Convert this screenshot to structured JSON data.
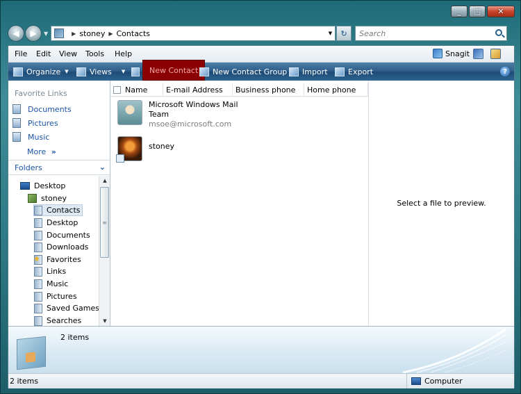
{
  "window": {
    "minimize": "_",
    "maximize": "□",
    "close": "✕"
  },
  "address": {
    "path": [
      "stoney",
      "Contacts"
    ],
    "search_placeholder": "Search"
  },
  "menu": [
    "File",
    "Edit",
    "View",
    "Tools",
    "Help"
  ],
  "snagit_label": "Snagit",
  "toolbar": {
    "organize": "Organize",
    "views": "Views",
    "new_contact": "New Contact",
    "new_contact_group": "New Contact Group",
    "import": "Import",
    "export": "Export",
    "help": "?"
  },
  "favorites": {
    "title": "Favorite Links",
    "items": [
      "Documents",
      "Pictures",
      "Music"
    ],
    "more": "More"
  },
  "folders": {
    "title": "Folders",
    "tree": [
      {
        "label": "Desktop",
        "level": 0,
        "icon": "desktop-icon"
      },
      {
        "label": "stoney",
        "level": 1,
        "icon": "user-folder-icon"
      },
      {
        "label": "Contacts",
        "level": 2,
        "icon": "folder-icon",
        "selected": true
      },
      {
        "label": "Desktop",
        "level": 2,
        "icon": "folder-icon"
      },
      {
        "label": "Documents",
        "level": 2,
        "icon": "folder-icon"
      },
      {
        "label": "Downloads",
        "level": 2,
        "icon": "folder-icon"
      },
      {
        "label": "Favorites",
        "level": 2,
        "icon": "favorites-folder-icon"
      },
      {
        "label": "Links",
        "level": 2,
        "icon": "folder-icon"
      },
      {
        "label": "Music",
        "level": 2,
        "icon": "music-folder-icon"
      },
      {
        "label": "Pictures",
        "level": 2,
        "icon": "folder-icon"
      },
      {
        "label": "Saved Games",
        "level": 2,
        "icon": "folder-icon"
      },
      {
        "label": "Searches",
        "level": 2,
        "icon": "folder-icon"
      }
    ]
  },
  "columns": [
    "Name",
    "E-mail Address",
    "Business phone",
    "Home phone"
  ],
  "contacts": [
    {
      "name_line1": "Microsoft Windows Mail",
      "name_line2": "Team",
      "email": "msoe@microsoft.com"
    },
    {
      "name_line1": "stoney",
      "name_line2": "",
      "email": ""
    }
  ],
  "preview_text": "Select a file to preview.",
  "details_text": "2 items",
  "status": {
    "left": "2 items",
    "right": "Computer"
  },
  "colors": {
    "highlight": "#8b0000",
    "link": "#1a53a3",
    "commandbar": "#2f5f8a"
  }
}
